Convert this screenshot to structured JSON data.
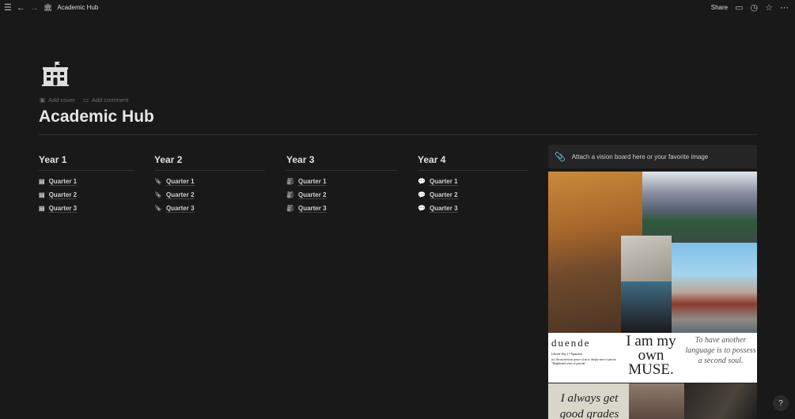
{
  "topbar": {
    "title": "Academic Hub",
    "share": "Share"
  },
  "page": {
    "title": "Academic Hub",
    "add_cover": "Add cover",
    "add_comment": "Add comment"
  },
  "columns": [
    {
      "title": "Year 1",
      "icon": "notebook-icon",
      "items": [
        "Quarter 1",
        "Quarter 2",
        "Quarter 3"
      ]
    },
    {
      "title": "Year 2",
      "icon": "bookmark-icon",
      "items": [
        "Quarter 1",
        "Quarter 2",
        "Quarter 3"
      ]
    },
    {
      "title": "Year 3",
      "icon": "backpack-icon",
      "items": [
        "Quarter 1",
        "Quarter 2",
        "Quarter 3"
      ]
    },
    {
      "title": "Year 4",
      "icon": "speech-bubble-icon",
      "items": [
        "Quarter 1",
        "Quarter 2",
        "Quarter 3"
      ]
    }
  ],
  "callout": {
    "text": "Attach a vision board here or your favorite image"
  },
  "vision_board": {
    "duende": "duende",
    "duende_pron": "[dwen-day] • Spanish",
    "duende_def": "(n.) the mysterious power of art to deeply move a person. \"Heightened sense of passion\"",
    "muse": "I am my own MUSE.",
    "language": "To have another language is to possess a second soul.",
    "grades": "I always get good grades"
  },
  "help": "?"
}
